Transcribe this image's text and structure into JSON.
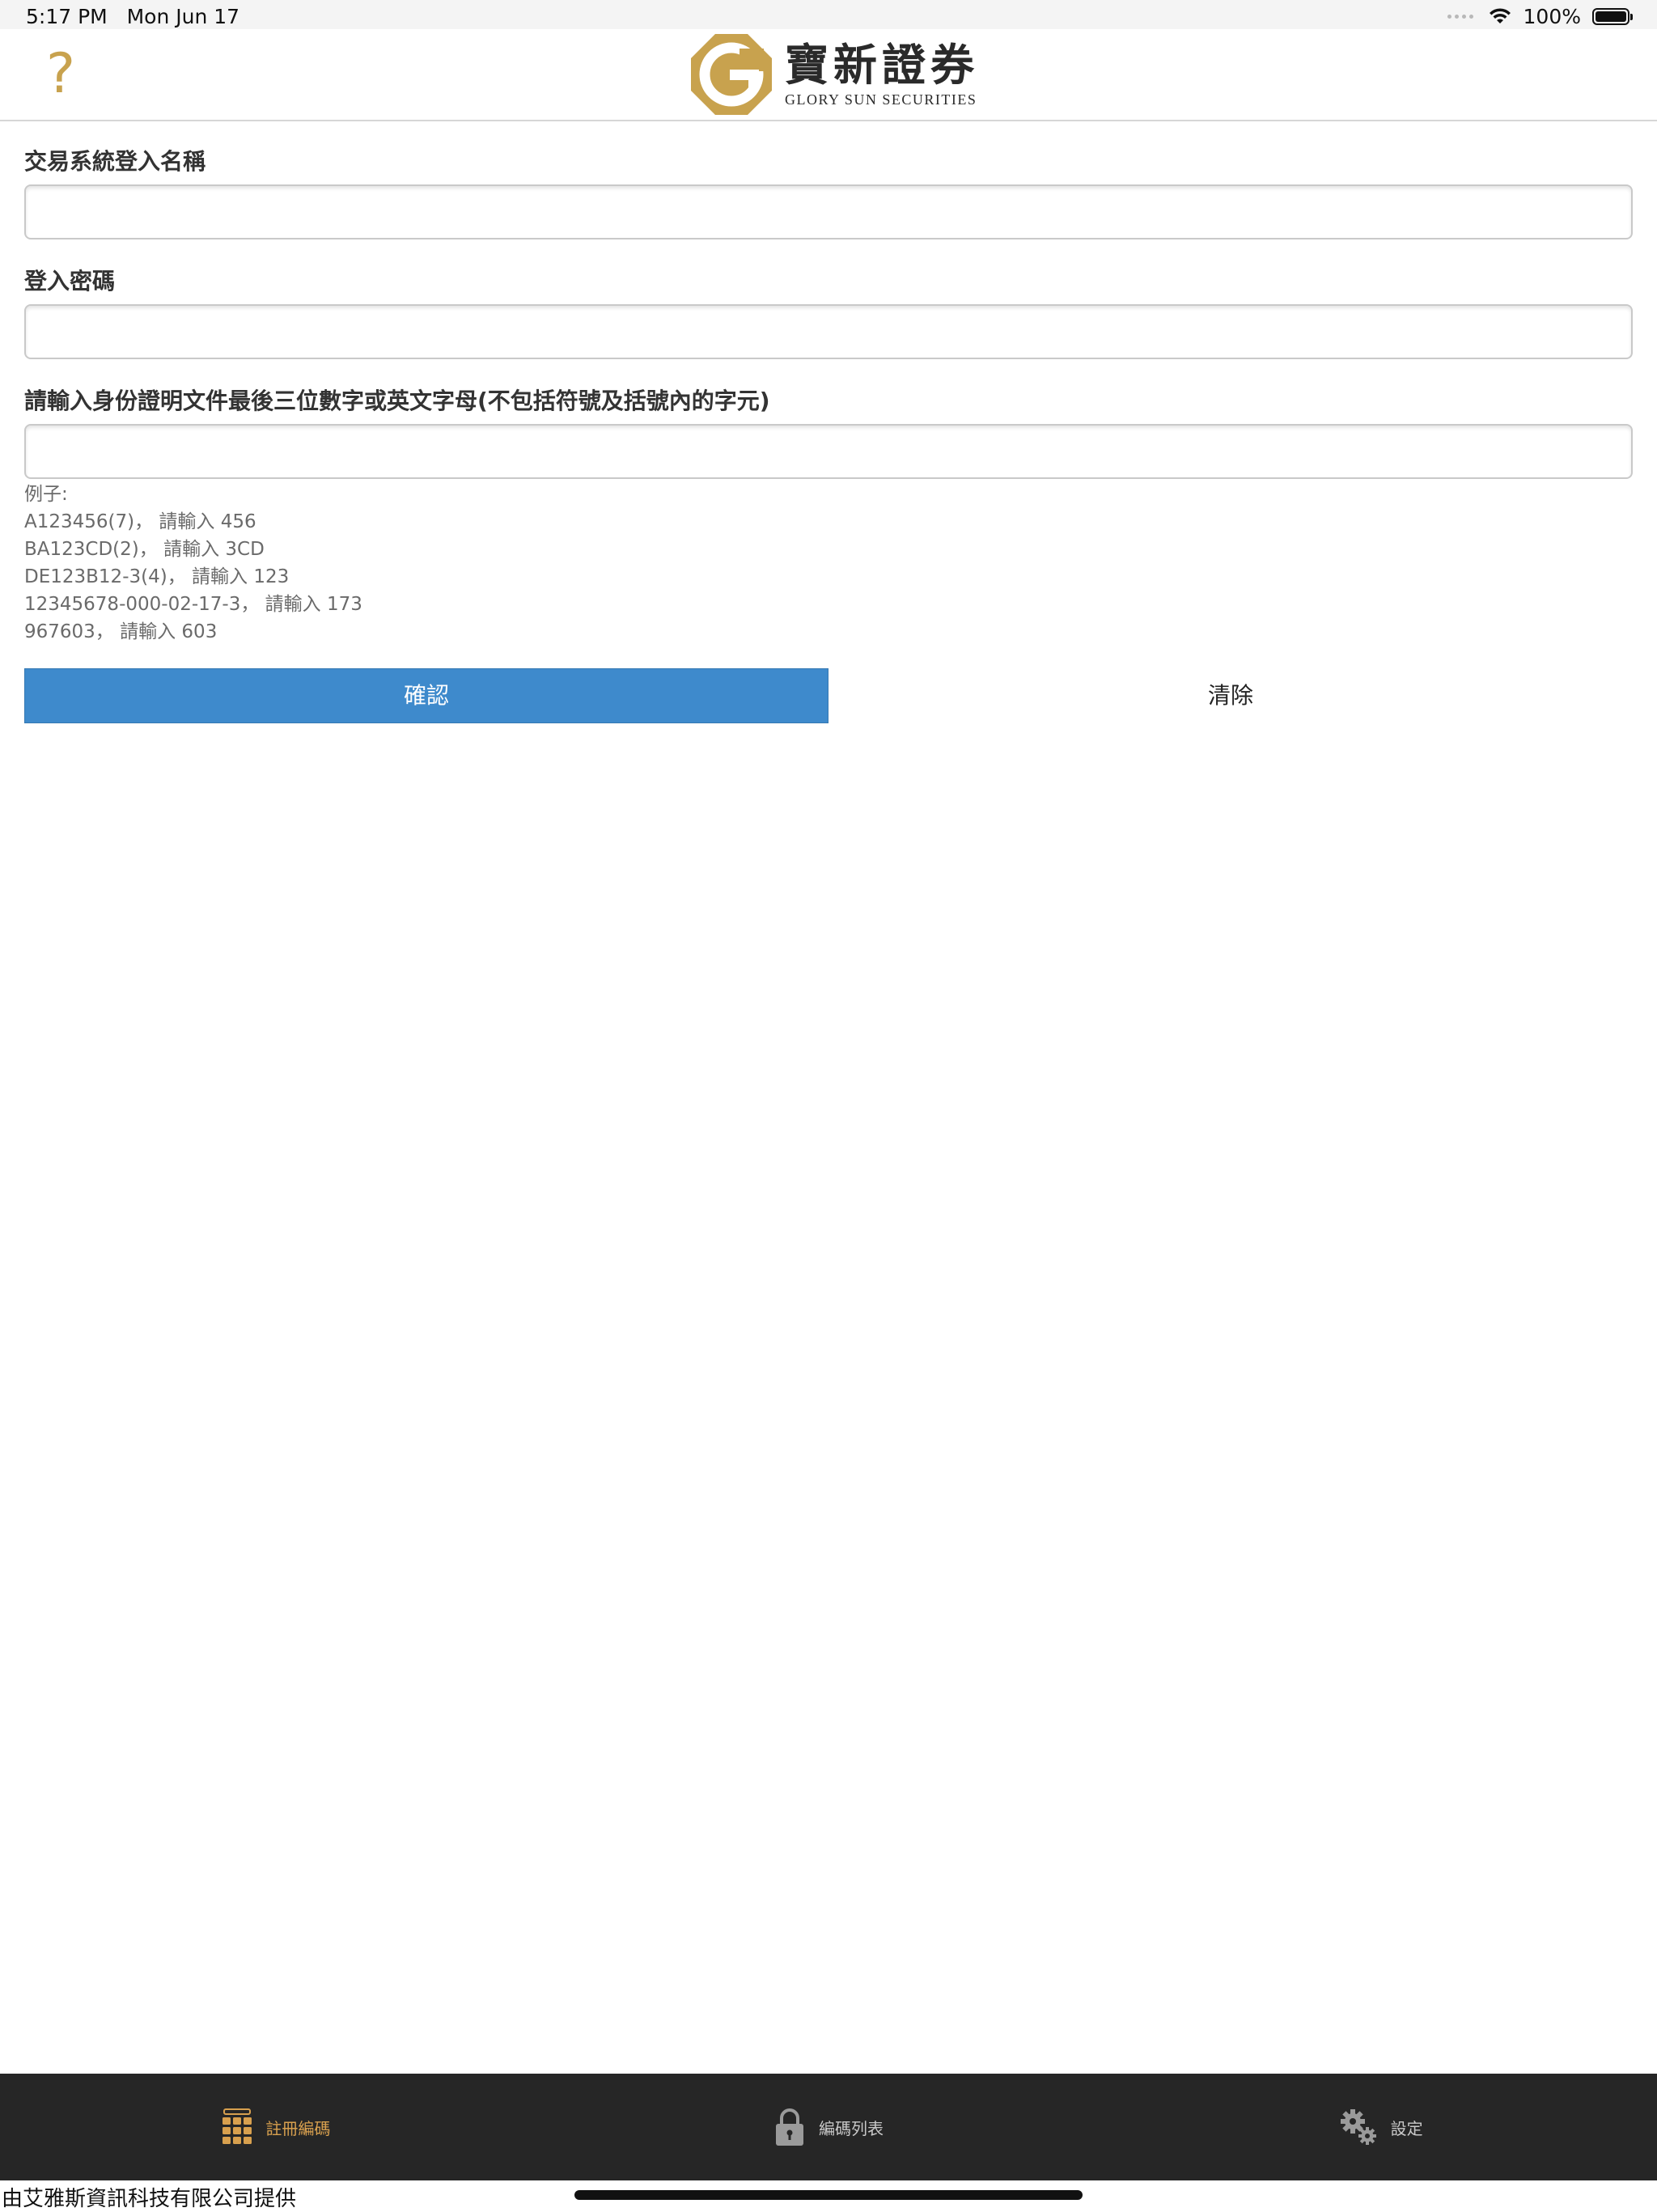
{
  "status_bar": {
    "time": "5:17 PM",
    "date": "Mon Jun 17",
    "battery": "100%"
  },
  "header": {
    "help_icon": "question-mark-icon",
    "logo_cn": "寶新證券",
    "logo_en": "GLORY SUN SECURITIES",
    "logo_color": "#c8a24e"
  },
  "form": {
    "username_label": "交易系統登入名稱",
    "username_value": "",
    "password_label": "登入密碼",
    "password_value": "",
    "id_label": "請輸入身份證明文件最後三位數字或英文字母(不包括符號及括號內的字元)",
    "id_value": "",
    "examples_title": "例子:",
    "examples": [
      "A123456(7)， 請輸入 456",
      "BA123CD(2)， 請輸入 3CD",
      "DE123B12-3(4)， 請輸入 123",
      "12345678-000-02-17-3， 請輸入 173",
      "967603， 請輸入 603"
    ],
    "confirm_label": "確認",
    "clear_label": "清除",
    "confirm_color": "#3e8acc"
  },
  "tab_bar": {
    "tabs": [
      {
        "label": "註冊編碼",
        "icon": "keypad-grid-icon",
        "active": true
      },
      {
        "label": "編碼列表",
        "icon": "padlock-icon",
        "active": false
      },
      {
        "label": "設定",
        "icon": "gears-icon",
        "active": false
      }
    ],
    "active_color": "#d8a04e"
  },
  "footer": {
    "text": "由艾雅斯資訊科技有限公司提供"
  }
}
